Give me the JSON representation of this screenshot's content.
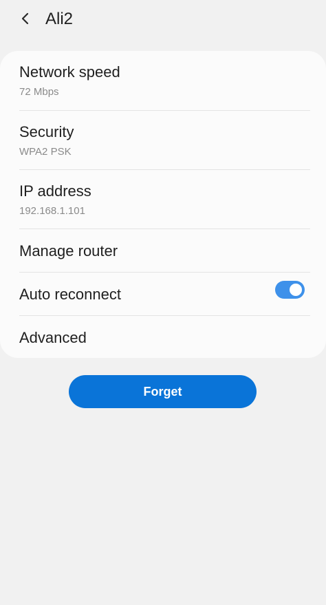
{
  "header": {
    "back_icon": "chevron-left-icon",
    "title": "Ali2"
  },
  "details": {
    "network_speed": {
      "label": "Network speed",
      "value": "72 Mbps"
    },
    "security": {
      "label": "Security",
      "value": "WPA2 PSK"
    },
    "ip_address": {
      "label": "IP address",
      "value": "192.168.1.101"
    },
    "manage_router": {
      "label": "Manage router"
    },
    "auto_reconnect": {
      "label": "Auto reconnect",
      "enabled": true
    },
    "advanced": {
      "label": "Advanced"
    }
  },
  "actions": {
    "forget_label": "Forget"
  },
  "colors": {
    "accent": "#3e91ea",
    "button": "#0a74d8",
    "background": "#f1f1f1",
    "card": "#fbfbfb"
  }
}
